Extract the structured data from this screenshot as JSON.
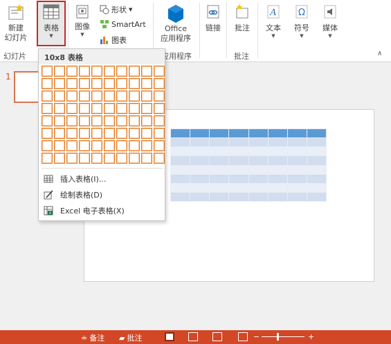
{
  "ribbon": {
    "new_slide": {
      "line1": "新建",
      "line2": "幻灯片",
      "icon": "new-slide-icon"
    },
    "table": {
      "label": "表格",
      "icon": "table-icon"
    },
    "image": {
      "label": "图像",
      "icon": "image-icon"
    },
    "shapes": {
      "label": "形状",
      "icon": "shapes-icon"
    },
    "smartart": {
      "label": "SmartArt",
      "icon": "smartart-icon"
    },
    "chart": {
      "label": "图表",
      "icon": "chart-icon"
    },
    "office_apps": {
      "line1": "Office",
      "line2": "应用程序",
      "icon": "office-icon"
    },
    "link": {
      "label": "链接",
      "icon": "link-icon"
    },
    "comment": {
      "label": "批注",
      "icon": "comment-icon"
    },
    "text": {
      "label": "文本",
      "icon": "text-icon"
    },
    "symbol": {
      "label": "符号",
      "icon": "omega-icon"
    },
    "media": {
      "label": "媒体",
      "icon": "speaker-icon"
    },
    "groups": {
      "slides": "幻灯片",
      "apps": "应用程序",
      "comments": "批注"
    }
  },
  "dropdown": {
    "header": "10x8 表格",
    "grid_cols": 10,
    "grid_rows": 8,
    "items": [
      {
        "label": "插入表格(I)...",
        "icon": "insert-table-icon"
      },
      {
        "label": "绘制表格(D)",
        "icon": "draw-table-icon"
      },
      {
        "label": "Excel 电子表格(X)",
        "icon": "excel-icon"
      }
    ]
  },
  "slides_panel": {
    "thumb_number": "1"
  },
  "status_bar": {
    "notes": "备注",
    "comments": "批注"
  },
  "colors": {
    "accent": "#d24726",
    "table_header": "#5b9bd5",
    "grid_border": "#e07b26",
    "office_blue": "#0072c6"
  }
}
